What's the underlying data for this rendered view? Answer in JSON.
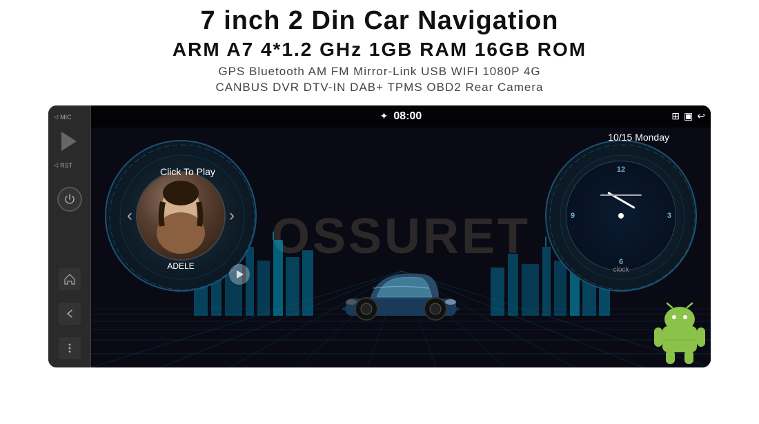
{
  "header": {
    "main_title": "7 inch 2 Din Car Navigation",
    "specs": "ARM A7 4*1.2 GHz    1GB RAM    16GB ROM",
    "features_line1": "GPS  Bluetooth  AM  FM  Mirror-Link  USB  WIFI  1080P  4G",
    "features_line2": "CANBUS   DVR   DTV-IN   DAB+   TPMS   OBD2   Rear Camera"
  },
  "screen": {
    "time": "08:00",
    "date": "10/15 Monday",
    "click_to_play": "Click To Play",
    "artist": "ADELE",
    "clock_label": "clock",
    "watermark": "OSSURET"
  },
  "status_bar": {
    "bluetooth_icon": "⚡",
    "expand_icon": "⊞",
    "back_icon": "↩"
  },
  "left_panel": {
    "mic_label": "MIC",
    "rst_label": "RST"
  }
}
